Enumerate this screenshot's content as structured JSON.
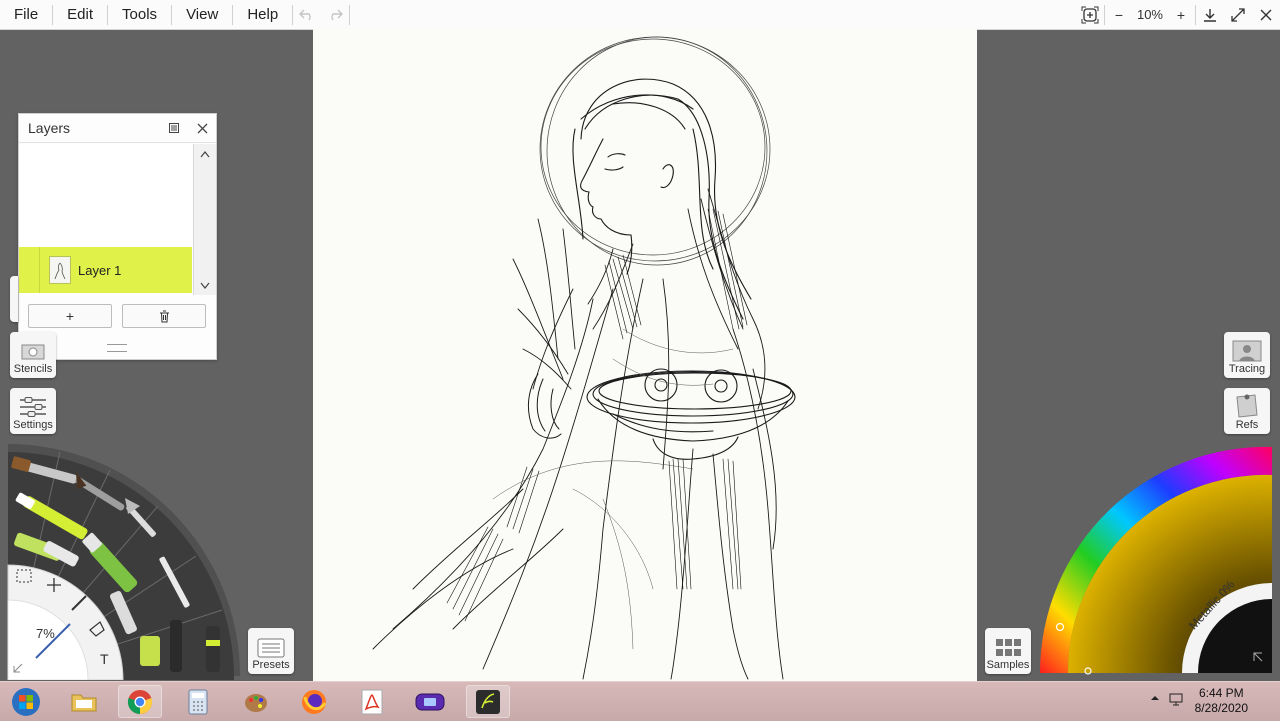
{
  "menu": {
    "items": [
      "File",
      "Edit",
      "Tools",
      "View",
      "Help"
    ],
    "zoom_label": "10%",
    "zoom_in": "+",
    "zoom_out": "−"
  },
  "layers": {
    "title": "Layers",
    "layer_name": "Layer 1",
    "add_label": "+"
  },
  "left_tools": {
    "stencils_label": "Stencils",
    "settings_label": "Settings",
    "presets_label": "Presets",
    "tool_size": "7%"
  },
  "right_tools": {
    "tracing_label": "Tracing",
    "refs_label": "Refs",
    "samples_label": "Samples",
    "metallic_label": "Metallic 0%"
  },
  "taskbar": {
    "time": "6:44 PM",
    "date": "8/28/2020"
  },
  "colors": {
    "accent_green": "#d4ee34",
    "canvas": "#fbfbf8",
    "workspace": "#626262"
  }
}
